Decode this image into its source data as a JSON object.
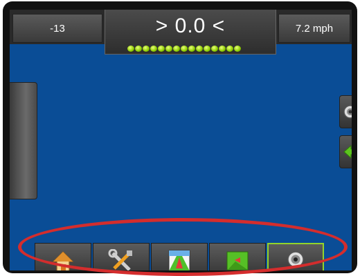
{
  "topbar": {
    "left_value": "-13",
    "center_value": "> 0.0 <",
    "right_value": "7.2 mph",
    "indicator_count": 15,
    "indicator_color": "#8ccc00"
  },
  "toolbar": {
    "tabs": [
      {
        "name": "home",
        "icon": "home-icon"
      },
      {
        "name": "tools",
        "icon": "tools-icon"
      },
      {
        "name": "guidance",
        "icon": "guidance-icon"
      },
      {
        "name": "map",
        "icon": "map-icon"
      },
      {
        "name": "camera",
        "icon": "camera-icon",
        "selected": true
      }
    ]
  },
  "colors": {
    "screen_background": "#0a4d96",
    "highlight": "#d42d2d",
    "selected_border": "#93d42a"
  }
}
